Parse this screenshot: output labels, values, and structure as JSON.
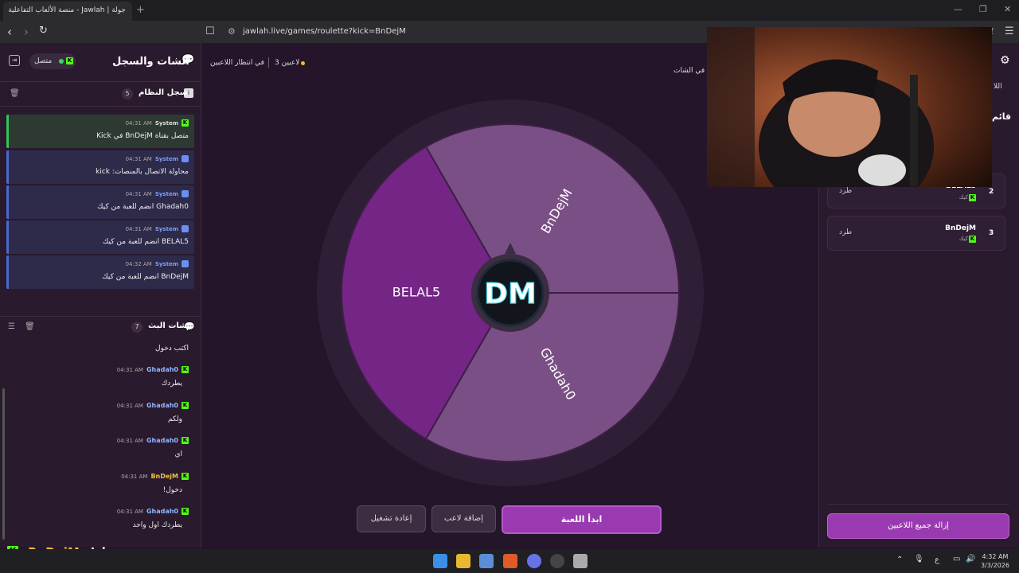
{
  "browser": {
    "tab_title": "جولة | Jawlah - منصة الألعاب التفاعلية",
    "new_tab": "+",
    "url": "jawlah.live/games/roulette?kick=BnDejM"
  },
  "left_panel": {
    "title": "الشات والسجل",
    "status": "متصل",
    "system_log": {
      "title": "سجل النظام",
      "count": "5",
      "messages": [
        {
          "author": "System",
          "time": "04:31 AM",
          "text": "متصل بقناة BnDejM في Kick"
        },
        {
          "author": "System",
          "time": "04:31 AM",
          "text": "محاولة الاتصال بالمنصات: kick"
        },
        {
          "author": "System",
          "time": "04:31 AM",
          "text": "Ghadah0 انضم للعبة من كيك"
        },
        {
          "author": "System",
          "time": "04:31 AM",
          "text": "BELAL5 انضم للعبة من كيك"
        },
        {
          "author": "System",
          "time": "04:32 AM",
          "text": "BnDejM انضم للعبة من كيك"
        }
      ]
    },
    "stream_chat": {
      "title": "شات البث",
      "count": "7",
      "top_text": "اكتب دخول",
      "messages": [
        {
          "author": "Ghadah0",
          "time": "04:31 AM",
          "text": "يطردك"
        },
        {
          "author": "Ghadah0",
          "time": "04:31 AM",
          "text": "ولكم"
        },
        {
          "author": "Ghadah0",
          "time": "04:31 AM",
          "text": "اي"
        },
        {
          "author": "BnDejM",
          "time": "04:31 AM",
          "text": "دخول!"
        },
        {
          "author": "Ghadah0",
          "time": "04:31 AM",
          "text": "يطردك اول واحد"
        }
      ]
    }
  },
  "overlay": {
    "name": "BnDejM",
    "text": "دخول!"
  },
  "main": {
    "players_count": "3 لاعبين",
    "waiting": "في انتظار اللاعبين",
    "in_chat": "في الشات",
    "wheel": {
      "logo": "DM",
      "segments": [
        "BnDejM",
        "Ghadah0",
        "BELAL5"
      ],
      "colors": [
        "#7a4f85",
        "#7a4f85",
        "#742585"
      ]
    },
    "buttons": {
      "start": "ابدأ اللعبة",
      "add_player": "إضافة لاعب",
      "restart": "إعادة تشغيل"
    }
  },
  "right_panel": {
    "tab_label": "اللا",
    "list_title": "قائم",
    "players": [
      {
        "rank": "2",
        "name": "BELAL5",
        "platform": "كيك",
        "action": "طرد"
      },
      {
        "rank": "3",
        "name": "BnDejM",
        "platform": "كيك",
        "action": "طرد"
      }
    ],
    "remove_all": "إزالة جميع اللاعبين"
  },
  "taskbar": {
    "time": "4:32 AM",
    "date": "3/3/2026",
    "lang": "ع"
  }
}
